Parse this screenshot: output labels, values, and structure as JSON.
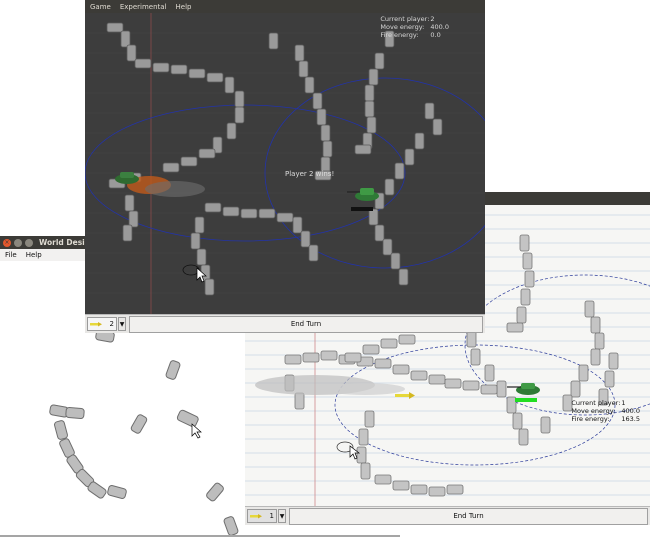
{
  "world_designer": {
    "title": "World Designer",
    "menu": [
      "File",
      "Help"
    ],
    "icons": [
      "close-icon",
      "minimize-icon",
      "maximize-icon"
    ]
  },
  "game_window_player2": {
    "menu": [
      "Game",
      "Experimental",
      "Help"
    ],
    "hud": {
      "current_player_label": "Current player:",
      "current_player_value": "2",
      "move_energy_label": "Move energy:",
      "move_energy_value": "400.0",
      "fire_energy_label": "Fire energy:",
      "fire_energy_value": "0.0"
    },
    "win_message": "Player 2 wins!",
    "weapon_selector_value": "2",
    "end_turn_label": "End Turn",
    "colors": {
      "background": "#3d3d3d",
      "tank_bar": "#111111"
    }
  },
  "game_window_player1": {
    "hud": {
      "current_player_label": "Current player:",
      "current_player_value": "1",
      "move_energy_label": "Move energy:",
      "move_energy_value": "400.0",
      "fire_energy_label": "Fire energy:",
      "fire_energy_value": "163.5"
    },
    "weapon_selector_value": "1",
    "end_turn_label": "End Turn",
    "colors": {
      "paper": "#f6f6f4",
      "line": "#c9d6e6",
      "margin": "#d08a8a",
      "tank_bar": "#22dd22"
    }
  }
}
